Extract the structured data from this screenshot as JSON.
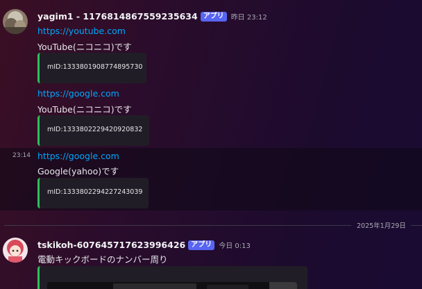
{
  "messages": [
    {
      "username": "yagim1 - 1176814867559235634",
      "app_tag": "アプリ",
      "timestamp": "昨日 23:12",
      "entries": [
        {
          "link": "https://youtube.com",
          "text": "YouTube(ニコニコ)です",
          "embed": "mID:1333801908774895730"
        },
        {
          "link": "https://google.com",
          "text": "YouTube(ニコニコ)です",
          "embed": "mID:1333802229420920832"
        },
        {
          "side_time": "23:14",
          "link": "https://google.com",
          "text": "Google(yahoo)です",
          "embed": "mID:1333802294227243039"
        }
      ]
    },
    {
      "username": "tskikoh-607645717623996426",
      "app_tag": "アプリ",
      "timestamp": "今日 0:13",
      "text": "電動キックボードのナンバー周り"
    }
  ],
  "date_divider": "2025年1月29日",
  "colors": {
    "link": "#00a8fc",
    "app_tag": "#5865f2",
    "embed_border": "#2fbf5a"
  }
}
